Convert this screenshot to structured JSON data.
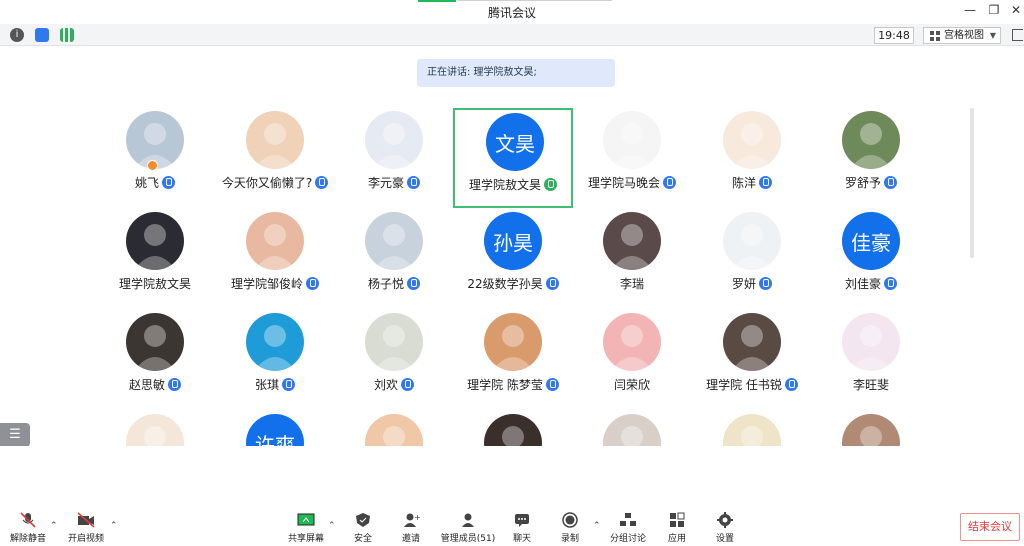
{
  "window": {
    "title": "腾讯会议"
  },
  "info_bar": {
    "time": "19:48",
    "view_mode": "宫格视图"
  },
  "speaking": {
    "text": "正在讲话: 理学院敖文昊;"
  },
  "participants": [
    {
      "name": "姚飞",
      "avatar": "photo",
      "color": "#b8c7d6",
      "mic": "on"
    },
    {
      "name": "今天你又偷懒了?",
      "avatar": "photo",
      "color": "#f0d2b8",
      "mic": "on"
    },
    {
      "name": "李元豪",
      "avatar": "photo",
      "color": "#e6eaf2",
      "mic": "on"
    },
    {
      "name": "理学院敖文昊",
      "avatar": "text",
      "avatar_text": "文昊",
      "color": "#1170ea",
      "mic": "speaking",
      "active": true
    },
    {
      "name": "理学院马晚会",
      "avatar": "photo",
      "color": "#f5f5f5",
      "mic": "on"
    },
    {
      "name": "陈洋",
      "avatar": "photo",
      "color": "#f7e9dc",
      "mic": "on"
    },
    {
      "name": "罗舒予",
      "avatar": "photo",
      "color": "#6f8a5a",
      "mic": "on"
    },
    {
      "name": "理学院敖文昊",
      "avatar": "photo",
      "color": "#2b2b33",
      "mic": "none"
    },
    {
      "name": "理学院邹俊岭",
      "avatar": "photo",
      "color": "#e8b9a0",
      "mic": "on"
    },
    {
      "name": "杨子悦",
      "avatar": "photo",
      "color": "#c8d2dc",
      "mic": "on"
    },
    {
      "name": "22级数学孙昊",
      "avatar": "text",
      "avatar_text": "孙昊",
      "color": "#1170ea",
      "mic": "on"
    },
    {
      "name": "李瑞",
      "avatar": "photo",
      "color": "#5a4a4a",
      "mic": "none"
    },
    {
      "name": "罗妍",
      "avatar": "photo",
      "color": "#eef2f5",
      "mic": "on"
    },
    {
      "name": "刘佳豪",
      "avatar": "text",
      "avatar_text": "佳豪",
      "color": "#1170ea",
      "mic": "on"
    },
    {
      "name": "赵思敏",
      "avatar": "photo",
      "color": "#3c3633",
      "mic": "on"
    },
    {
      "name": "张琪",
      "avatar": "photo",
      "color": "#1f9bd8",
      "mic": "on"
    },
    {
      "name": "刘欢",
      "avatar": "photo",
      "color": "#d9dcd2",
      "mic": "on"
    },
    {
      "name": "理学院 陈梦莹",
      "avatar": "photo",
      "color": "#d99a6c",
      "mic": "on"
    },
    {
      "name": "闫荣欣",
      "avatar": "photo",
      "color": "#f2b4b4",
      "mic": "none"
    },
    {
      "name": "理学院 任书锐",
      "avatar": "photo",
      "color": "#5a4a44",
      "mic": "on"
    },
    {
      "name": "李旺斐",
      "avatar": "photo",
      "color": "#f3e6f0",
      "mic": "none"
    },
    {
      "name": "",
      "avatar": "photo",
      "color": "#f5e6da",
      "mic": "none"
    },
    {
      "name": "",
      "avatar": "text",
      "avatar_text": "许爽",
      "color": "#1170ea",
      "mic": "none"
    },
    {
      "name": "",
      "avatar": "photo",
      "color": "#f0c8a8",
      "mic": "none"
    },
    {
      "name": "",
      "avatar": "photo",
      "color": "#3a2f2b",
      "mic": "none"
    },
    {
      "name": "",
      "avatar": "photo",
      "color": "#d8d0c8",
      "mic": "none"
    },
    {
      "name": "",
      "avatar": "photo",
      "color": "#efe3c8",
      "mic": "none"
    },
    {
      "name": "",
      "avatar": "photo",
      "color": "#b08a74",
      "mic": "none"
    }
  ],
  "toolbar": {
    "unmute": "解除静音",
    "start_video": "开启视频",
    "share_screen": "共享屏幕",
    "security": "安全",
    "invite": "邀请",
    "manage_members": "管理成员(51)",
    "chat": "聊天",
    "record": "录制",
    "breakout": "分组讨论",
    "apps": "应用",
    "settings": "设置",
    "end_meeting": "结束会议"
  },
  "colors": {
    "accent": "#1170ea",
    "active_border": "#3fbf74",
    "end_button": "#e33b3b"
  }
}
